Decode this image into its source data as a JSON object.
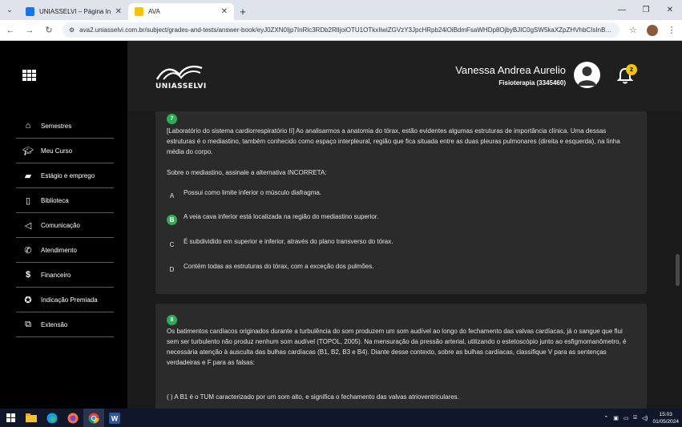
{
  "browser": {
    "tabs": [
      {
        "title": "UNIASSELVI – Página Inicial",
        "active": false
      },
      {
        "title": "AVA",
        "active": true
      }
    ],
    "url": "ava2.uniasselvi.com.br/subject/grades-and-tests/answer-book/eyJ0ZXN0Ijp7InRlc3RDb2RlIjoiOTU1OTkxIiwiZGVzY3JpcHRpb24iOiBdmFsaWHDp8OjbyBJIC0gSW5kaXZpZHVhbCIsInBhcmF..."
  },
  "sidebar": {
    "items": [
      {
        "label": "Semestres",
        "icon": "home-icon"
      },
      {
        "label": "Meu Curso",
        "icon": "graduation-cap-icon"
      },
      {
        "label": "Estágio e emprego",
        "icon": "briefcase-icon"
      },
      {
        "label": "Biblioteca",
        "icon": "book-icon"
      },
      {
        "label": "Comunicação",
        "icon": "megaphone-icon"
      },
      {
        "label": "Atendimento",
        "icon": "phone-icon"
      },
      {
        "label": "Financeiro",
        "icon": "dollar-icon"
      },
      {
        "label": "Indicação Premiada",
        "icon": "medal-icon"
      },
      {
        "label": "Extensão",
        "icon": "extension-icon"
      }
    ]
  },
  "header": {
    "logo_text": "UNIASSELVI",
    "user_name": "Vanessa Andrea Aurelio",
    "user_course": "Fisioterapia (3345460)",
    "notification_count": "2"
  },
  "q7": {
    "number": "7",
    "text": "[Laboratório do sistema cardiorrespiratório II] Ao analisarmos a anatomia do tórax, estão evidentes algumas estruturas de importância clínica. Uma dessas estruturas é o mediastino, também conhecido como espaço interpleural, região que fica situada entre as duas pleuras pulmonares (direita e esquerda), na linha média do corpo.",
    "prompt": "Sobre o mediastino, assinale a alternativa INCORRETA:",
    "alternatives": [
      {
        "letter": "A",
        "text": "Possui como limite inferior o músculo diafragma.",
        "selected": false
      },
      {
        "letter": "B",
        "text": "A veia cava inferior está localizada na região do mediastino superior.",
        "selected": true
      },
      {
        "letter": "C",
        "text": "É subdividido em superior e inferior, através do plano transverso do tórax.",
        "selected": false
      },
      {
        "letter": "D",
        "text": "Contém todas as estruturas do tórax, com a exceção dos pulmões.",
        "selected": false
      }
    ]
  },
  "q8": {
    "number": "8",
    "text": "Os batimentos cardíacos originados durante a turbulência do som produzem um som audível ao longo do fechamento das valvas cardíacas, já o sangue que flui sem ser turbulento não produz nenhum som audível (TOPOL, 2005). Na mensuração da pressão arterial, utilizando o estetoscópio junto ao esfigmomanômetro, é necessária atenção à ausculta das bulhas cardíacas (B1, B2, B3 e B4). Diante desse contexto, sobre as bulhas cardíacas, classifique V para as sentenças verdadeiras e F para as falsas:",
    "statement1": "(   ) A B1 é o TUM caracterizado por um som alto, e significa o fechamento das valvas atrioventriculares."
  },
  "taskbar": {
    "time": "15:03",
    "date": "01/05/2024"
  }
}
